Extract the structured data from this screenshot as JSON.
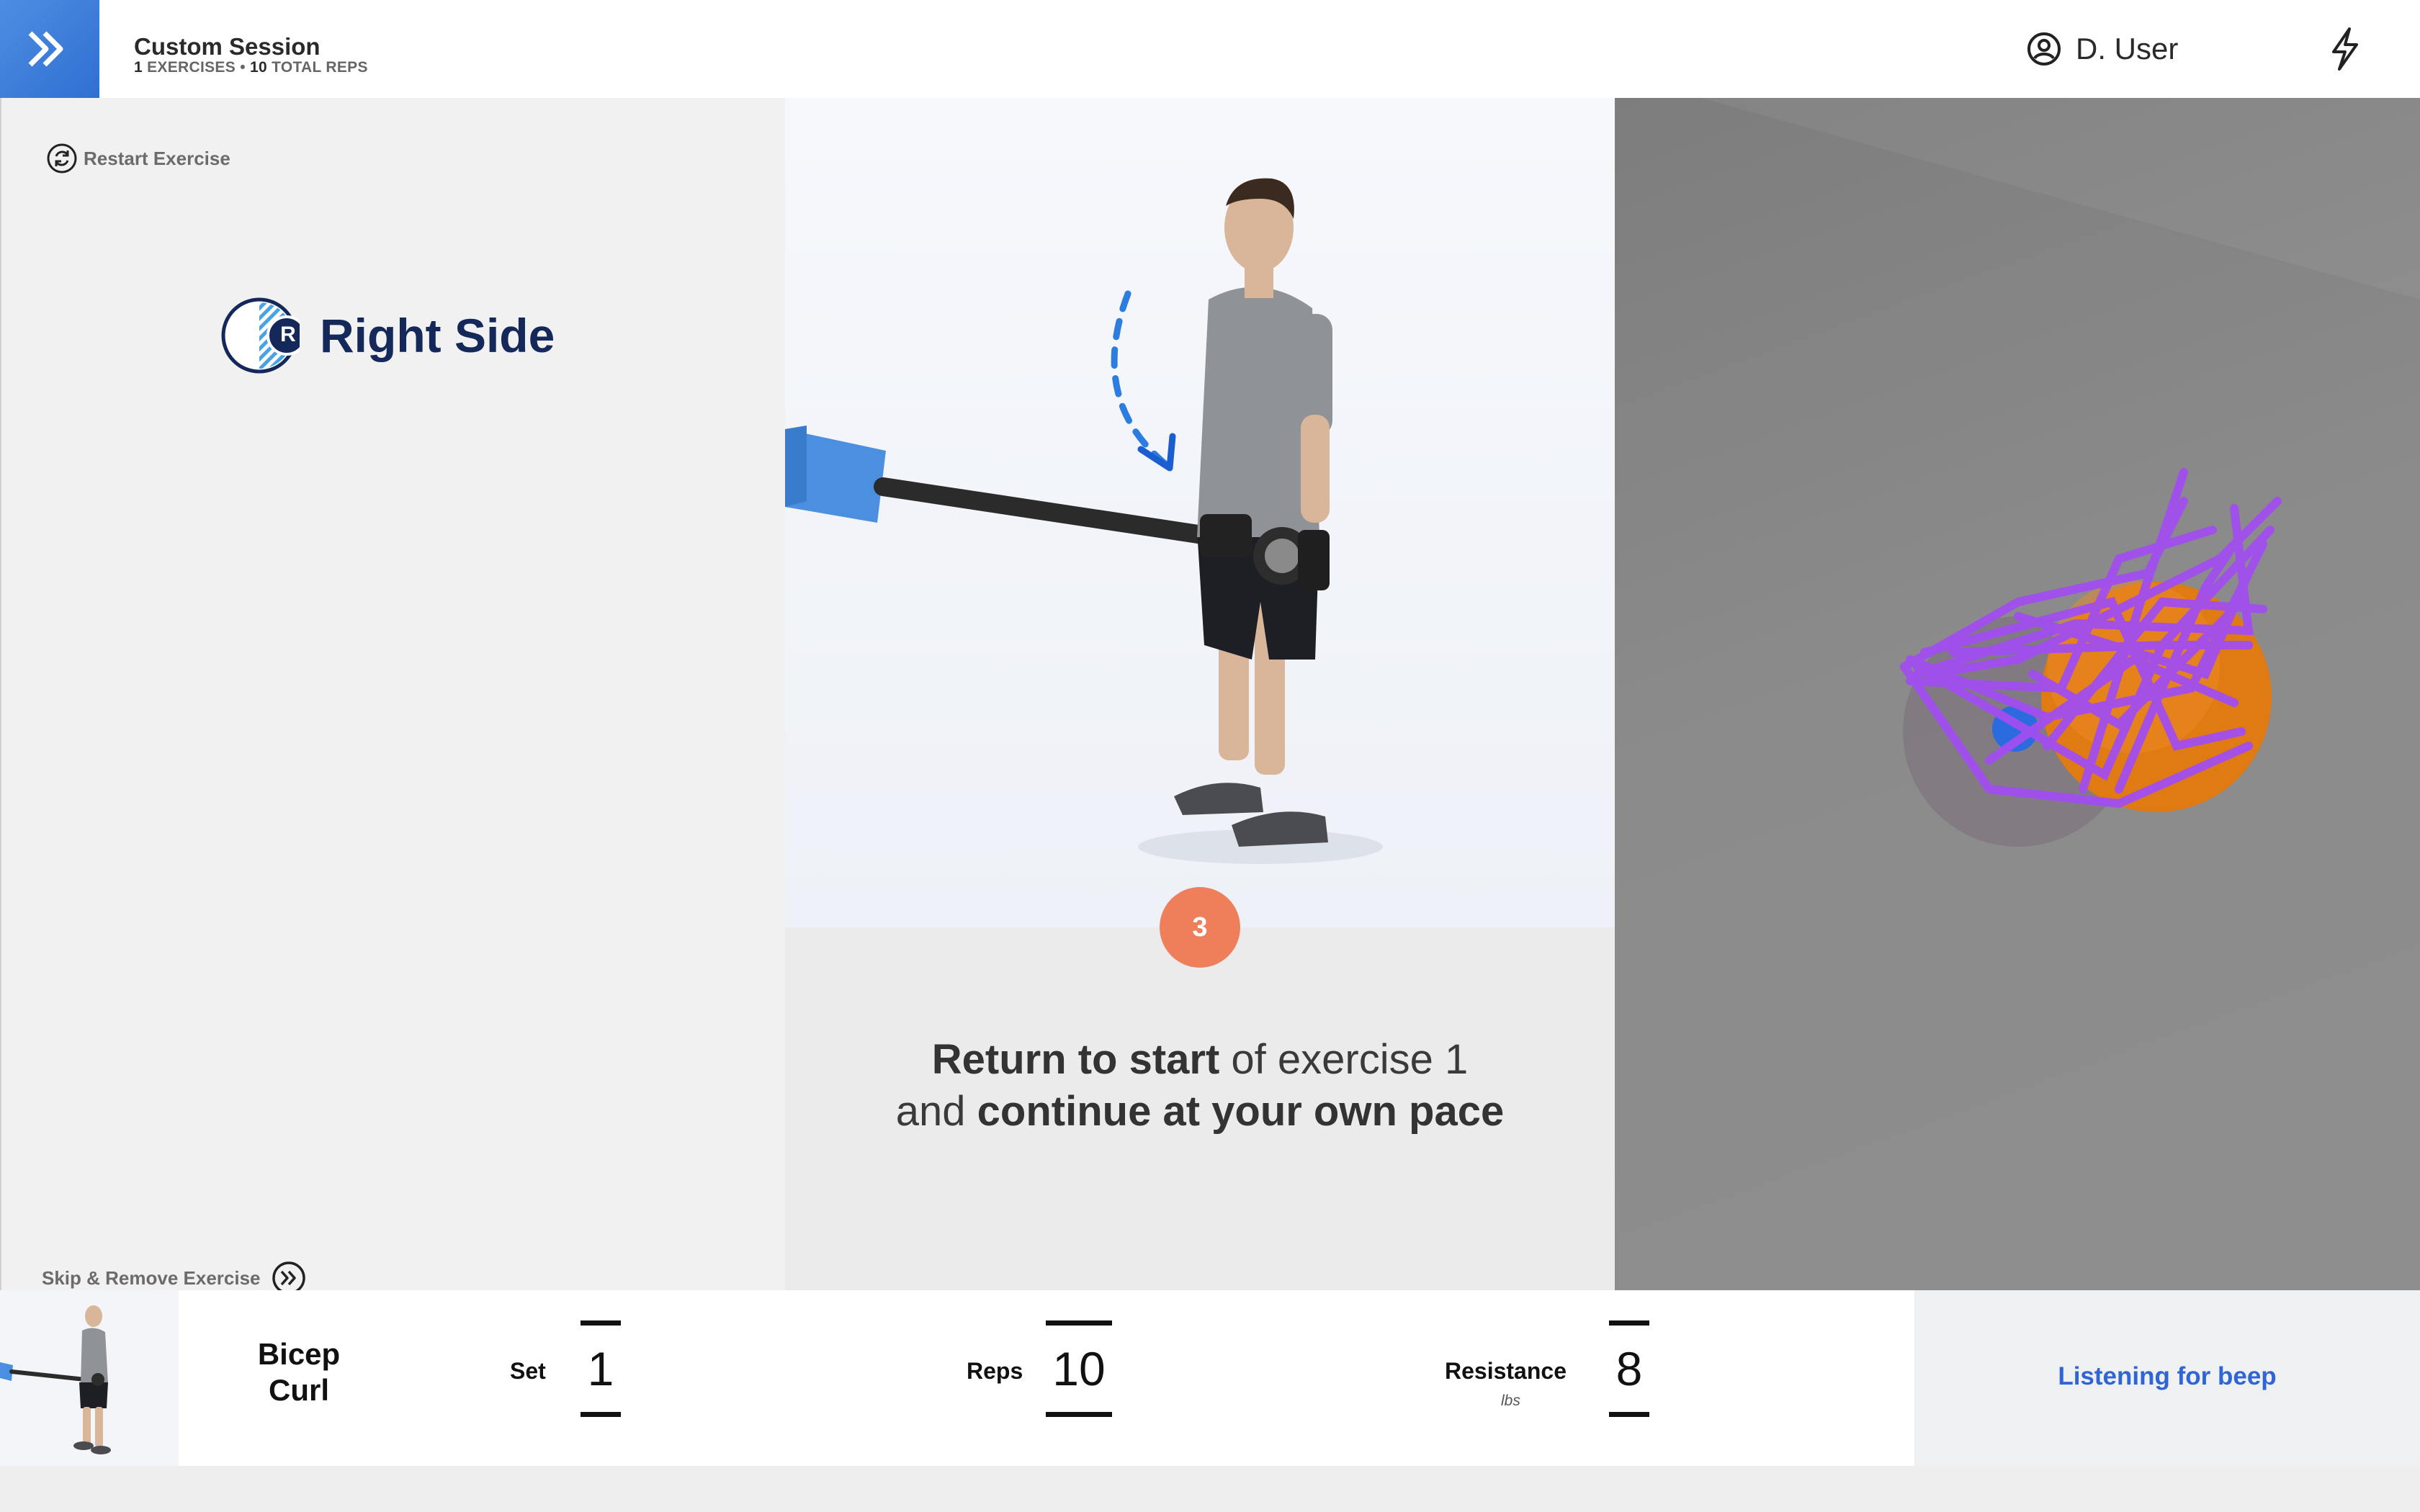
{
  "header": {
    "session_title": "Custom Session",
    "exercise_count": "1",
    "exercises_label": "EXERCISES",
    "separator": "•",
    "rep_count": "10",
    "reps_label": "TOTAL REPS",
    "user_name": "D. User",
    "logo_icon": "double-chevron-icon",
    "user_icon": "user-circle-icon",
    "status_icon": "lightning-bolt-icon"
  },
  "left_panel": {
    "restart_label": "Restart Exercise",
    "side_badge_letter": "R",
    "side_label": "Right Side",
    "skip_label": "Skip & Remove Exercise"
  },
  "center_panel": {
    "step_number": "3",
    "instruction_line1_bold": "Return to start",
    "instruction_line1_rest": " of exercise 1",
    "instruction_line2_prefix": "and ",
    "instruction_line2_bold": "continue at your own pace"
  },
  "bottom_bar": {
    "exercise_name_line1": "Bicep",
    "exercise_name_line2": "Curl",
    "set_label": "Set",
    "set_value": "1",
    "reps_label": "Reps",
    "reps_value": "10",
    "resistance_label": "Resistance",
    "resistance_unit": "lbs",
    "resistance_value": "8",
    "status_text": "Listening for beep"
  },
  "colors": {
    "brand_blue": "#2f6fd1",
    "navy": "#14285a",
    "step_orange": "#ef7f5a",
    "status_blue": "#2f66d3",
    "tracker_purple": "#a24ef0",
    "tracker_orange": "#e07a12"
  }
}
